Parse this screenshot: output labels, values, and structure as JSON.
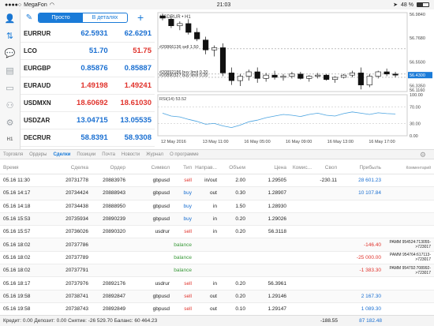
{
  "status": {
    "carrier": "MegaFon",
    "time": "21:03",
    "battery": "48 %",
    "battery_level": 0.48
  },
  "quotes": {
    "mode_simple": "Просто",
    "mode_detail": "В деталях",
    "rows": [
      {
        "symbol": "EURRUR",
        "bid": "62.5931",
        "ask": "62.6291",
        "bid_color": "blue",
        "ask_color": "blue"
      },
      {
        "symbol": "LCO",
        "bid": "51.70",
        "ask": "51.75",
        "bid_color": "blue",
        "ask_color": "red"
      },
      {
        "symbol": "EURGBP",
        "bid": "0.85876",
        "ask": "0.85887",
        "bid_color": "blue",
        "ask_color": "blue"
      },
      {
        "symbol": "EURAUD",
        "bid": "1.49198",
        "ask": "1.49241",
        "bid_color": "red",
        "ask_color": "red"
      },
      {
        "symbol": "USDMXN",
        "bid": "18.60692",
        "ask": "18.61030",
        "bid_color": "red",
        "ask_color": "red"
      },
      {
        "symbol": "USDZAR",
        "bid": "13.04715",
        "ask": "13.05535",
        "bid_color": "blue",
        "ask_color": "blue"
      },
      {
        "symbol": "DECRUR",
        "bid": "58.8391",
        "ask": "58.9308",
        "bid_color": "blue",
        "ask_color": "blue"
      }
    ]
  },
  "sidebar": {
    "h1_label": "H1"
  },
  "chart": {
    "title": "USDRUR • H1",
    "price_labels": [
      "56.9840",
      "56.7680",
      "56.5500",
      "56.4300",
      "56.3350",
      "56.1160"
    ],
    "current_price": "56.4300",
    "rsi_label": "RSI(14) 53.52",
    "rsi_levels": [
      "100.00",
      "70.00",
      "30.00",
      "0.00"
    ],
    "time_labels": [
      "12 May 2016",
      "13 May 11:00",
      "16 May 05:00",
      "16 May 09:00",
      "16 May 13:00",
      "16 May 17:00"
    ],
    "order_labels": [
      "#20866136 sell 1.50",
      "#20892186 buy limit 0.20",
      "#20890327 buy limit 0.20"
    ],
    "candles": [
      {
        "o": 56.97,
        "h": 56.99,
        "l": 56.93,
        "c": 56.95
      },
      {
        "o": 56.94,
        "h": 56.96,
        "l": 56.86,
        "c": 56.88
      },
      {
        "o": 56.88,
        "h": 56.92,
        "l": 56.84,
        "c": 56.9
      },
      {
        "o": 56.9,
        "h": 56.94,
        "l": 56.8,
        "c": 56.82
      },
      {
        "o": 56.82,
        "h": 56.86,
        "l": 56.74,
        "c": 56.76
      },
      {
        "o": 56.75,
        "h": 56.78,
        "l": 56.62,
        "c": 56.66
      },
      {
        "o": 56.66,
        "h": 56.7,
        "l": 56.6,
        "c": 56.68
      },
      {
        "o": 56.68,
        "h": 56.72,
        "l": 56.42,
        "c": 56.45
      },
      {
        "o": 56.45,
        "h": 56.5,
        "l": 56.34,
        "c": 56.38
      },
      {
        "o": 56.38,
        "h": 56.44,
        "l": 56.33,
        "c": 56.42
      },
      {
        "o": 56.42,
        "h": 56.48,
        "l": 56.38,
        "c": 56.46
      },
      {
        "o": 56.46,
        "h": 56.5,
        "l": 56.36,
        "c": 56.4
      },
      {
        "o": 56.4,
        "h": 56.45,
        "l": 56.37,
        "c": 56.43
      },
      {
        "o": 56.43,
        "h": 56.47,
        "l": 56.39,
        "c": 56.41
      },
      {
        "o": 56.41,
        "h": 56.44,
        "l": 56.38,
        "c": 56.42
      },
      {
        "o": 56.42,
        "h": 56.46,
        "l": 56.4,
        "c": 56.44
      },
      {
        "o": 56.44,
        "h": 56.46,
        "l": 56.39,
        "c": 56.4
      },
      {
        "o": 56.4,
        "h": 56.43,
        "l": 56.37,
        "c": 56.42
      },
      {
        "o": 56.42,
        "h": 56.45,
        "l": 56.4,
        "c": 56.43
      },
      {
        "o": 56.43,
        "h": 56.44,
        "l": 56.38,
        "c": 56.39
      },
      {
        "o": 56.39,
        "h": 56.42,
        "l": 56.36,
        "c": 56.41
      },
      {
        "o": 56.41,
        "h": 56.44,
        "l": 56.4,
        "c": 56.43
      },
      {
        "o": 56.43,
        "h": 56.47,
        "l": 56.41,
        "c": 56.45
      },
      {
        "o": 56.45,
        "h": 56.5,
        "l": 56.3,
        "c": 56.34
      },
      {
        "o": 56.34,
        "h": 56.44,
        "l": 56.32,
        "c": 56.42
      },
      {
        "o": 56.42,
        "h": 56.47,
        "l": 56.4,
        "c": 56.46
      },
      {
        "o": 56.46,
        "h": 56.49,
        "l": 56.42,
        "c": 56.44
      },
      {
        "o": 56.44,
        "h": 56.46,
        "l": 56.41,
        "c": 56.43
      }
    ],
    "rsi": [
      55,
      48,
      46,
      40,
      35,
      28,
      30,
      24,
      20,
      26,
      34,
      38,
      44,
      48,
      52,
      50,
      47,
      52,
      55,
      50,
      48,
      54,
      58,
      55,
      52,
      56,
      54,
      53
    ]
  },
  "tabs": [
    "Торговля",
    "Ордеры",
    "Сделки",
    "Позиции",
    "Почта",
    "Новости",
    "Журнал",
    "О программе"
  ],
  "active_tab": 2,
  "table": {
    "headers": [
      "Время",
      "Сделка",
      "Ордер",
      "Символ",
      "Тип",
      "Направ...",
      "Объем",
      "Цена",
      "Комис...",
      "Своп",
      "Прибыль",
      "Комментарий"
    ],
    "rows": [
      {
        "time": "05.16 11:30",
        "deal": "20731778",
        "order": "20883976",
        "symbol": "gbpusd",
        "type": "sell",
        "dir": "in/out",
        "vol": "2.00",
        "price": "1.29505",
        "comm": "",
        "swap": "-230.11",
        "profit": "28 601.23",
        "profit_color": "blue",
        "comment": ""
      },
      {
        "time": "05.16 14:17",
        "deal": "20734424",
        "order": "20888943",
        "symbol": "gbpusd",
        "type": "buy",
        "dir": "out",
        "vol": "0.30",
        "price": "1.28907",
        "comm": "",
        "swap": "",
        "profit": "10 107.84",
        "profit_color": "blue",
        "comment": ""
      },
      {
        "time": "05.16 14:18",
        "deal": "20734438",
        "order": "20888950",
        "symbol": "gbpusd",
        "type": "buy",
        "dir": "in",
        "vol": "1.50",
        "price": "1.28930",
        "comm": "",
        "swap": "",
        "profit": "",
        "profit_color": "blue",
        "comment": ""
      },
      {
        "time": "05.16 15:53",
        "deal": "20735934",
        "order": "20890239",
        "symbol": "gbpusd",
        "type": "buy",
        "dir": "in",
        "vol": "0.20",
        "price": "1.29026",
        "comm": "",
        "swap": "",
        "profit": "",
        "profit_color": "blue",
        "comment": ""
      },
      {
        "time": "05.16 15:57",
        "deal": "20736026",
        "order": "20890320",
        "symbol": "usdrur",
        "type": "sell",
        "dir": "in",
        "vol": "0.20",
        "price": "56.3118",
        "comm": "",
        "swap": "",
        "profit": "",
        "profit_color": "blue",
        "comment": ""
      },
      {
        "time": "05.16 18:02",
        "deal": "20737786",
        "order": "",
        "symbol": "",
        "type": "balance",
        "dir": "",
        "vol": "",
        "price": "",
        "comm": "",
        "swap": "",
        "profit": "-146.40",
        "profit_color": "red",
        "comment": "PAMM 954524:713055->723017"
      },
      {
        "time": "05.16 18:02",
        "deal": "20737789",
        "order": "",
        "symbol": "",
        "type": "balance",
        "dir": "",
        "vol": "",
        "price": "",
        "comm": "",
        "swap": "",
        "profit": "-25 000.00",
        "profit_color": "red",
        "comment": "PAMM 954764:617113->723017"
      },
      {
        "time": "05.16 18:02",
        "deal": "20737791",
        "order": "",
        "symbol": "",
        "type": "balance",
        "dir": "",
        "vol": "",
        "price": "",
        "comm": "",
        "swap": "",
        "profit": "-1 383.30",
        "profit_color": "red",
        "comment": "PAMM 954792:708992->723017"
      },
      {
        "time": "05.16 18:17",
        "deal": "20737976",
        "order": "20892176",
        "symbol": "usdrur",
        "type": "sell",
        "dir": "in",
        "vol": "0.20",
        "price": "56.3961",
        "comm": "",
        "swap": "",
        "profit": "",
        "profit_color": "blue",
        "comment": ""
      },
      {
        "time": "05.16 19:58",
        "deal": "20738741",
        "order": "20892847",
        "symbol": "gbpusd",
        "type": "sell",
        "dir": "out",
        "vol": "0.20",
        "price": "1.29146",
        "comm": "",
        "swap": "",
        "profit": "2 167.30",
        "profit_color": "blue",
        "comment": ""
      },
      {
        "time": "05.16 19:58",
        "deal": "20738743",
        "order": "20892849",
        "symbol": "gbpusd",
        "type": "sell",
        "dir": "out",
        "vol": "0.10",
        "price": "1.29147",
        "comm": "",
        "swap": "",
        "profit": "1 089.30",
        "profit_color": "blue",
        "comment": ""
      }
    ]
  },
  "footer": {
    "summary": "Кредит: 0.00  Депозит: 0.00  Снятие: -26 529.70  Баланс: 60 464.23",
    "swap": "-188.55",
    "profit": "87 182.48"
  }
}
